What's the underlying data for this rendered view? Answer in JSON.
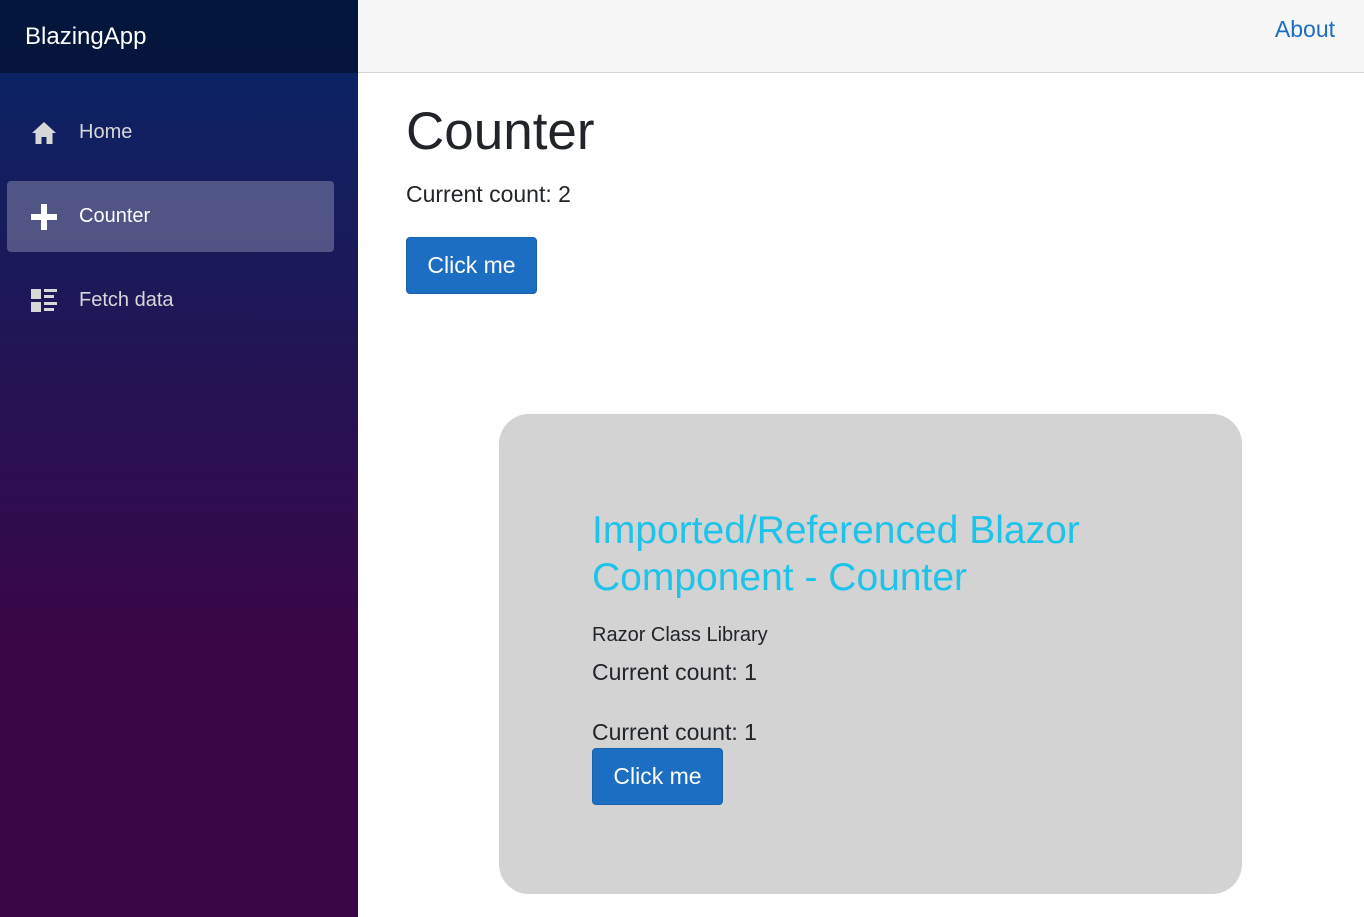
{
  "brand": "BlazingApp",
  "top_row": {
    "about": "About"
  },
  "nav": {
    "items": [
      {
        "label": "Home",
        "icon": "home-icon",
        "active": false
      },
      {
        "label": "Counter",
        "icon": "plus-icon",
        "active": true
      },
      {
        "label": "Fetch data",
        "icon": "list-rich-icon",
        "active": false
      }
    ]
  },
  "main": {
    "title": "Counter",
    "count_text": "Current count: 2",
    "button_label": "Click me"
  },
  "library": {
    "title": "Imported/Referenced Blazor Component - Counter",
    "subtitle": "Razor Class Library",
    "count_text_1": "Current count: 1",
    "count_text_2": "Current count: 1",
    "button_label": "Click me"
  },
  "colors": {
    "accent": "#1b6ec2",
    "library_title": "#1ec3ea",
    "sidebar_top": "#052767",
    "sidebar_bottom": "#3a0647",
    "card_bg": "#d3d3d3"
  }
}
